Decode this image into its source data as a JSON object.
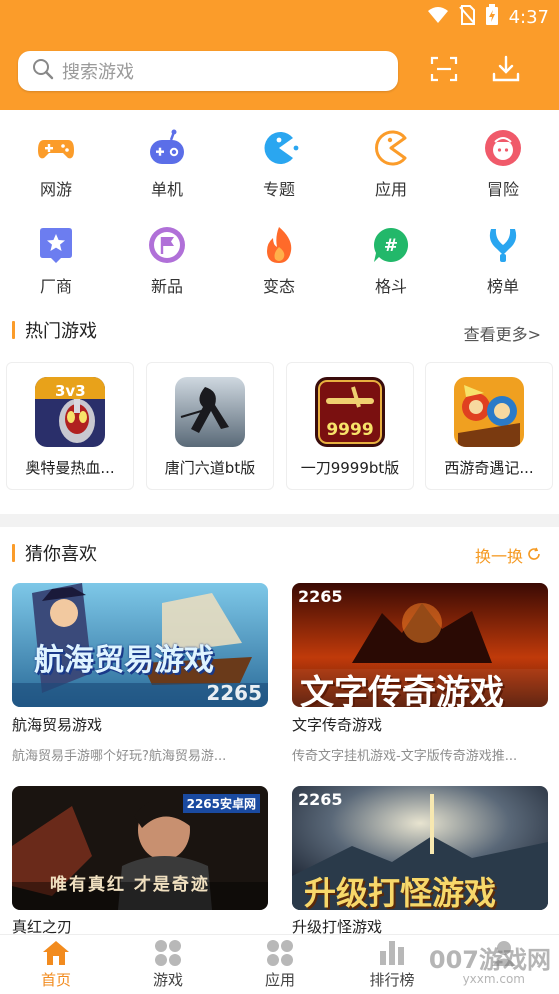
{
  "colors": {
    "accent": "#fb9c2a",
    "accent_text": "#f28b1e",
    "muted": "#8d8d8d"
  },
  "status_bar": {
    "time": "4:37",
    "icons": [
      "wifi-icon",
      "no-sim-icon",
      "battery-charging-icon"
    ]
  },
  "header": {
    "search_placeholder": "搜索游戏",
    "search_icon": "search-icon",
    "scan_icon": "scan-icon",
    "download_icon": "download-icon"
  },
  "categories": [
    {
      "label": "网游",
      "icon": "gamepad-icon",
      "color": "#fb9c2a"
    },
    {
      "label": "单机",
      "icon": "controller-icon",
      "color": "#5b6ee8"
    },
    {
      "label": "专题",
      "icon": "pacman-icon",
      "color": "#2aa6f0"
    },
    {
      "label": "应用",
      "icon": "pacman-outline-icon",
      "color": "#fb9c2a"
    },
    {
      "label": "冒险",
      "icon": "face-icon",
      "color": "#f05a6a"
    },
    {
      "label": "厂商",
      "icon": "star-badge-icon",
      "color": "#6c7df0"
    },
    {
      "label": "新品",
      "icon": "flag-icon",
      "color": "#b070d8"
    },
    {
      "label": "变态",
      "icon": "flame-icon",
      "color": "#ff6a2a"
    },
    {
      "label": "格斗",
      "icon": "hashtag-chat-icon",
      "color": "#22b86a"
    },
    {
      "label": "榜单",
      "icon": "trophy-icon",
      "color": "#2aa6f0"
    }
  ],
  "hot_games": {
    "title": "热门游戏",
    "more_label": "查看更多>",
    "items": [
      {
        "name": "奥特曼热血...",
        "icon": "ultraman-game-icon"
      },
      {
        "name": "唐门六道bt版",
        "icon": "tangmen-game-icon"
      },
      {
        "name": "一刀9999bt版",
        "icon": "yidao-game-icon",
        "art": "9999"
      },
      {
        "name": "西游奇遇记...",
        "icon": "xiyou-game-icon"
      }
    ]
  },
  "recommend": {
    "title": "猜你喜欢",
    "refresh_label": "换一换",
    "refresh_icon": "refresh-icon",
    "items": [
      {
        "title": "航海贸易游戏",
        "desc": "航海贸易手游哪个好玩?航海贸易游...",
        "overlay": "航海贸易游戏",
        "tag": "2265"
      },
      {
        "title": "文字传奇游戏",
        "desc": "传奇文字挂机游戏-文字版传奇游戏推...",
        "overlay": "文字传奇游戏",
        "tag": "2265"
      },
      {
        "title": "真红之刃",
        "desc": "",
        "overlay": "唯有真红  才是奇迹",
        "tag": "2265安卓网"
      },
      {
        "title": "升级打怪游戏",
        "desc": "",
        "overlay": "升级打怪游戏",
        "tag": "2265"
      }
    ]
  },
  "bottom_nav": [
    {
      "label": "首页",
      "icon": "home-icon",
      "active": true
    },
    {
      "label": "游戏",
      "icon": "grid-icon",
      "active": false
    },
    {
      "label": "应用",
      "icon": "apps-icon",
      "active": false
    },
    {
      "label": "排行榜",
      "icon": "bar-chart-icon",
      "active": false
    },
    {
      "label": "",
      "icon": "user-icon",
      "active": false
    }
  ],
  "watermark": {
    "text": "007游戏网",
    "sub": "yxxm.com"
  }
}
